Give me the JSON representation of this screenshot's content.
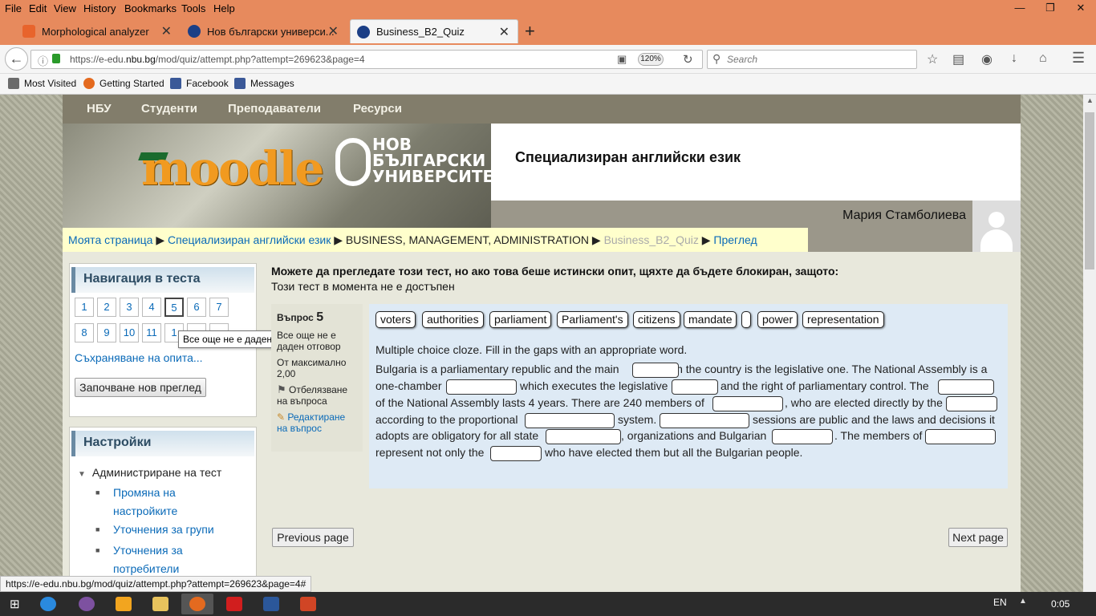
{
  "browser": {
    "menu": [
      "File",
      "Edit",
      "View",
      "History",
      "Bookmarks",
      "Tools",
      "Help"
    ],
    "tabs": [
      {
        "label": "Morphological analyzer",
        "icon": "orange-square-icon"
      },
      {
        "label": "Нов български универси...",
        "icon": "nbu-icon"
      },
      {
        "label": "Business_B2_Quiz",
        "icon": "nbu-icon"
      }
    ],
    "url_prefix": "https://e-edu.",
    "url_domain": "nbu.bg",
    "url_path": "/mod/quiz/attempt.php?attempt=269623&page=4",
    "zoom": "120%",
    "search_placeholder": "Search",
    "bookmarks": [
      "Most Visited",
      "Getting Started",
      "Facebook",
      "Messages"
    ],
    "status_url": "https://e-edu.nbu.bg/mod/quiz/attempt.php?attempt=269623&page=4#"
  },
  "site": {
    "topnav": [
      "НБУ",
      "Студенти",
      "Преподаватели",
      "Ресурси"
    ],
    "logo_text": "moodle",
    "logo_org": [
      "НОВ",
      "БЪЛГАРСКИ",
      "УНИВЕРСИТЕТ"
    ],
    "course_title": "Специализиран английски език",
    "user_name": "Мария Стамболиева",
    "breadcrumb": [
      {
        "label": "Моята страница",
        "link": true
      },
      {
        "label": "Специализиран английски език",
        "link": true
      },
      {
        "label": "BUSINESS, MANAGEMENT, ADMINISTRATION",
        "link": false
      },
      {
        "label": "Business_B2_Quiz",
        "link": false,
        "dim": true
      },
      {
        "label": "Преглед",
        "link": true
      }
    ]
  },
  "quiznav": {
    "title": "Навигация в теста",
    "row1": [
      "1",
      "2",
      "3",
      "4",
      "5",
      "6",
      "7"
    ],
    "row2": [
      "8",
      "9",
      "10",
      "11",
      "1"
    ],
    "tooltip": "Все още не е даден отговор",
    "save_link": "Съхраняване на опита...",
    "new_preview_button": "Започване нов преглед"
  },
  "settings": {
    "title": "Настройки",
    "admin_label": "Администриране на тест",
    "items": [
      "Промяна на настройките",
      "Уточнения за групи",
      "Уточнения за потребители"
    ],
    "item_lines": [
      [
        "Промяна на",
        "настройките"
      ],
      [
        "Уточнения за групи"
      ],
      [
        "Уточнения за",
        "потребители"
      ]
    ]
  },
  "message": {
    "bold": "Можете да прегледате този тест, но ако това беше истински опит, щяхте да бъдете блокиран, защото:",
    "normal": "Този тест в момента не е достъпен"
  },
  "question_info": {
    "label": "Въпрос",
    "number": "5",
    "status": "Все още не е даден отговор",
    "max_label": "От максимално",
    "max_value": "2,00",
    "flag": "Отбелязване на въпроса",
    "edit": "Редактиране на въпрос"
  },
  "question": {
    "drag_items": [
      "voters",
      "authorities",
      "parliament",
      "Parliament's",
      "citizens",
      "mandate",
      "",
      "power",
      "representation"
    ],
    "instruction": "Multiple choice cloze. Fill in the gaps with an appropriate word.",
    "lines": [
      [
        "Bulgaria is a parliamentary republic and the main",
        "in the country is the legislative one. The National Assembly is a"
      ],
      [
        "one-chamber",
        "which executes the legislative",
        "and the right of parliamentary control. The"
      ],
      [
        "of the National Assembly lasts 4 years. There are 240 members of",
        ", who are elected directly by the"
      ],
      [
        "according to the proportional",
        "system.",
        "sessions are public and the laws and decisions it"
      ],
      [
        "adopts are obligatory for all state",
        ", organizations and Bulgarian",
        ". The members of"
      ],
      [
        "represent not only the",
        "who have elected them but all the Bulgarian people."
      ]
    ]
  },
  "pager": {
    "prev": "Previous page",
    "next": "Next page"
  },
  "taskbar": {
    "lang": "EN",
    "time": "0:05"
  }
}
